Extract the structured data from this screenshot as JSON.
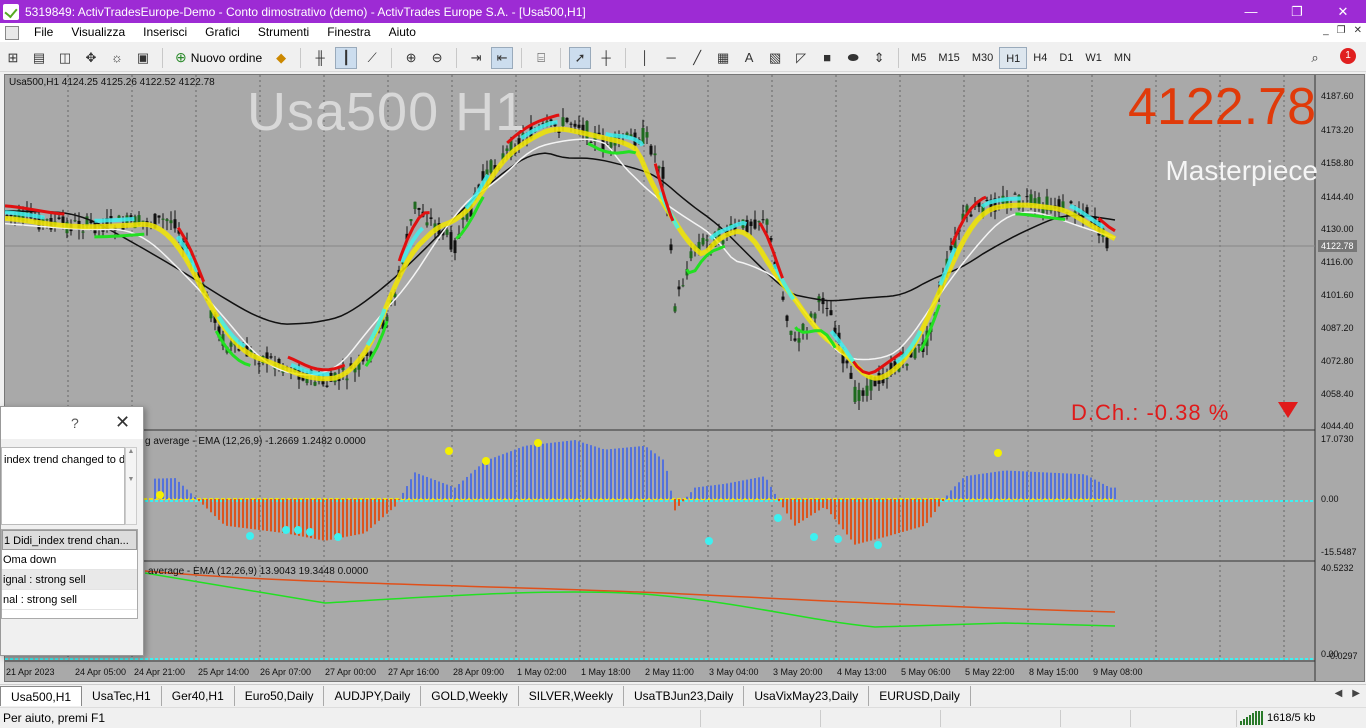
{
  "window": {
    "title": "5319849: ActivTradesEurope-Demo - Conto dimostrativo (demo) - ActivTrades Europe S.A. - [Usa500,H1]",
    "minimize": "—",
    "restore": "❐",
    "close": "✕"
  },
  "menu": [
    "File",
    "Visualizza",
    "Inserisci",
    "Grafici",
    "Strumenti",
    "Finestra",
    "Aiuto"
  ],
  "toolbar": {
    "new_order": "Nuovo ordine",
    "timeframes": [
      "M5",
      "M15",
      "M30",
      "H1",
      "H4",
      "D1",
      "W1",
      "MN"
    ],
    "selected_timeframe": "H1",
    "notifications": "1"
  },
  "chart": {
    "symbol_info": "Usa500,H1  4124.25 4125.26 4122.52 4122.78",
    "watermark": "Usa500 H1",
    "current_price": "4122.78",
    "label": "Masterpiece",
    "daily_change": "D.Ch.: -0.38 %",
    "price_axis": [
      "4187.60",
      "4173.20",
      "4158.80",
      "4144.40",
      "4130.00",
      "4116.00",
      "4101.60",
      "4087.20",
      "4072.80",
      "4058.40",
      "4044.40"
    ],
    "price_tag": "4122.78",
    "indicator1_label": "g average - EMA (12,26,9) -1.2669 1.2482 0.0000",
    "indicator1_axis": [
      "17.0730",
      "0.00",
      "-15.5487"
    ],
    "indicator2_label": "average - EMA (12,26,9) 13.9043 19.3448 0.0000",
    "indicator2_axis": [
      "40.5232",
      "0.00",
      "-0.0297"
    ],
    "time_axis": [
      "21 Apr 2023",
      "24 Apr 05:00",
      "24 Apr 21:00",
      "25 Apr 14:00",
      "26 Apr 07:00",
      "27 Apr 00:00",
      "27 Apr 16:00",
      "28 Apr 09:00",
      "1 May 02:00",
      "1 May 18:00",
      "2 May 11:00",
      "3 May 04:00",
      "3 May 20:00",
      "4 May 13:00",
      "5 May 06:00",
      "5 May 22:00",
      "8 May 15:00",
      "9 May 08:00"
    ]
  },
  "alert_dialog": {
    "help": "?",
    "close": "✕",
    "message": "index trend changed to d",
    "rows": [
      "1 Didi_index trend chan...",
      "Oma down",
      "ignal : strong sell",
      "nal : strong sell"
    ]
  },
  "tabs": [
    "Usa500,H1",
    "UsaTec,H1",
    "Ger40,H1",
    "Euro50,Daily",
    "AUDJPY,Daily",
    "GOLD,Weekly",
    "SILVER,Weekly",
    "UsaTBJun23,Daily",
    "UsaVixMay23,Daily",
    "EURUSD,Daily"
  ],
  "status": {
    "help": "Per aiuto, premi F1",
    "traffic": "1618/5 kb"
  },
  "colors": {
    "titlebar": "#9d2bd4",
    "chart_bg": "#a9a9a9",
    "price_big": "#e03a0a",
    "daily_change": "#e01a1a"
  }
}
